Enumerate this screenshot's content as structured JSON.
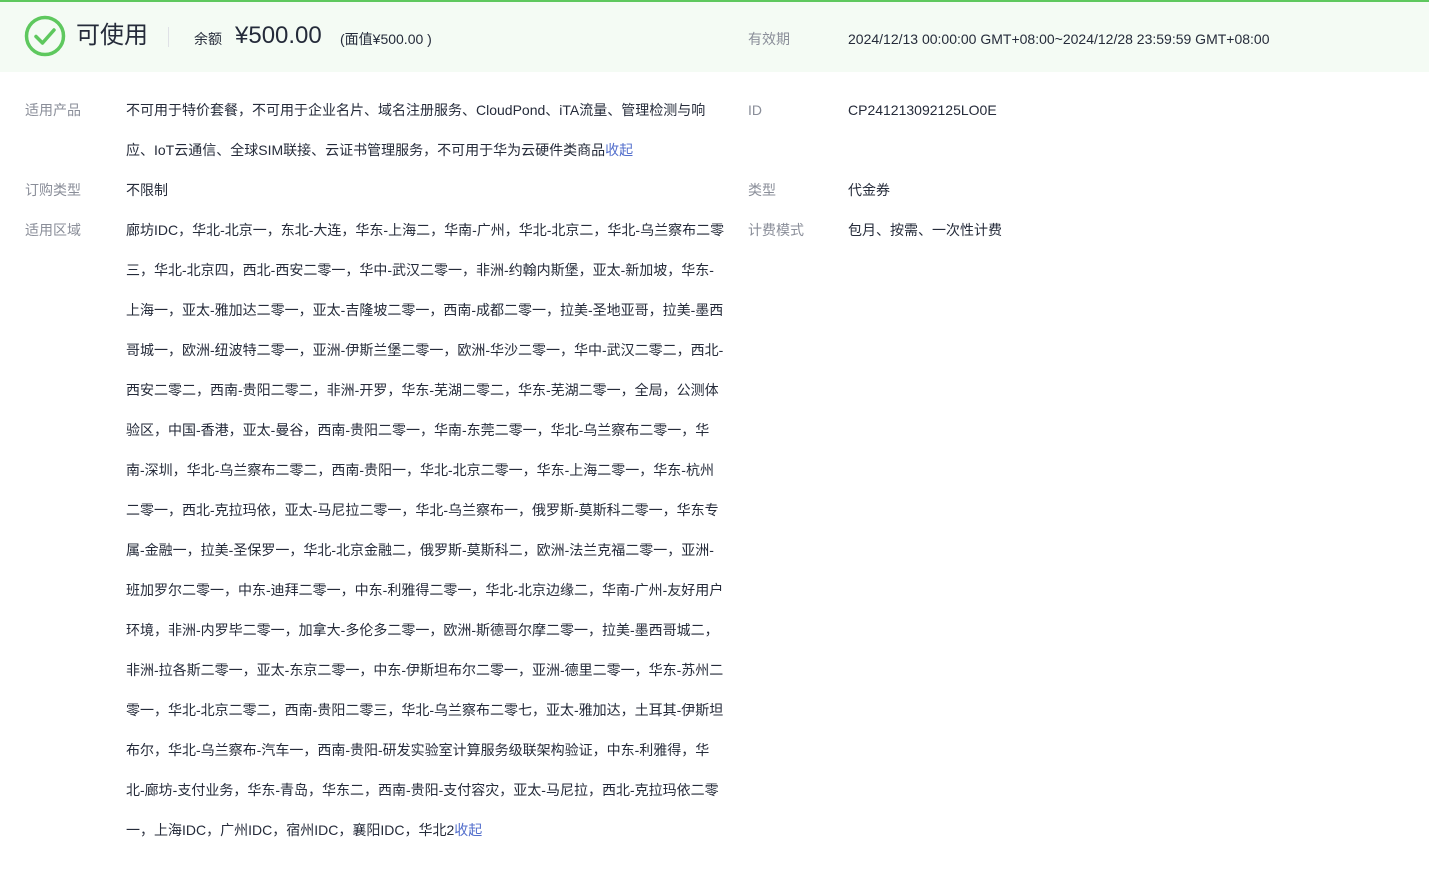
{
  "header": {
    "status_text": "可使用",
    "balance_label": "余额",
    "balance_amount": "¥500.00",
    "face_value": "(面值¥500.00 )",
    "validity_label": "有效期",
    "validity_value": "2024/12/13 00:00:00 GMT+08:00~2024/12/28 23:59:59 GMT+08:00",
    "status_icon": "check-circle-icon",
    "accent_color": "#5ec85e"
  },
  "details": {
    "products_label": "适用产品",
    "products_value": "不可用于特价套餐，不可用于企业名片、域名注册服务、CloudPond、iTA流量、管理检测与响应、IoT云通信、全球SIM联接、云证书管理服务，不可用于华为云硬件类商品",
    "products_collapse": "收起",
    "id_label": "ID",
    "id_value": "CP241213092125LO0E",
    "order_type_label": "订购类型",
    "order_type_value": "不限制",
    "type_label": "类型",
    "type_value": "代金券",
    "region_label": "适用区域",
    "region_value": "廊坊IDC，华北-北京一，东北-大连，华东-上海二，华南-广州，华北-北京二，华北-乌兰察布二零三，华北-北京四，西北-西安二零一，华中-武汉二零一，非洲-约翰内斯堡，亚太-新加坡，华东-上海一，亚太-雅加达二零一，亚太-吉隆坡二零一，西南-成都二零一，拉美-圣地亚哥，拉美-墨西哥城一，欧洲-纽波特二零一，亚洲-伊斯兰堡二零一，欧洲-华沙二零一，华中-武汉二零二，西北-西安二零二，西南-贵阳二零二，非洲-开罗，华东-芜湖二零二，华东-芜湖二零一，全局，公测体验区，中国-香港，亚太-曼谷，西南-贵阳二零一，华南-东莞二零一，华北-乌兰察布二零一，华南-深圳，华北-乌兰察布二零二，西南-贵阳一，华北-北京二零一，华东-上海二零一，华东-杭州二零一，西北-克拉玛依，亚太-马尼拉二零一，华北-乌兰察布一，俄罗斯-莫斯科二零一，华东专属-金融一，拉美-圣保罗一，华北-北京金融二，俄罗斯-莫斯科二，欧洲-法兰克福二零一，亚洲-班加罗尔二零一，中东-迪拜二零一，中东-利雅得二零一，华北-北京边缘二，华南-广州-友好用户环境，非洲-内罗毕二零一，加拿大-多伦多二零一，欧洲-斯德哥尔摩二零一，拉美-墨西哥城二，非洲-拉各斯二零一，亚太-东京二零一，中东-伊斯坦布尔二零一，亚洲-德里二零一，华东-苏州二零一，华北-北京二零二，西南-贵阳二零三，华北-乌兰察布二零七，亚太-雅加达，土耳其-伊斯坦布尔，华北-乌兰察布-汽车一，西南-贵阳-研发实验室计算服务级联架构验证，中东-利雅得，华北-廊坊-支付业务，华东-青岛，华东二，西南-贵阳-支付容灾，亚太-马尼拉，西北-克拉玛依二零一，上海IDC，广州IDC，宿州IDC，襄阳IDC，华北2",
    "region_collapse": "收起",
    "billing_label": "计费模式",
    "billing_value": "包月、按需、一次性计费"
  }
}
